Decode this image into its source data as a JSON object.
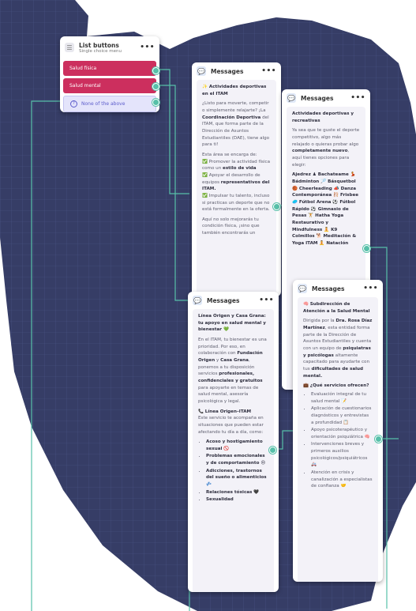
{
  "list_node": {
    "title": "List buttons",
    "subtitle": "Single choice menu",
    "options": [
      "Salud física",
      "Salud mental"
    ],
    "none_label": "None of the above"
  },
  "messages_header": "Messages",
  "msg1": {
    "heading": "✨ Actividades deportivas en el ITAM",
    "intro_a": "¿Listo para moverte, competir o simplemente relajarte? ¡La ",
    "intro_bold": "Coordinación Deportiva",
    "intro_b": " del ITAM, que forma parte de la Dirección de Asuntos Estudiantiles (DAE), tiene algo para ti!",
    "area_intro": "Esta área se encarga de:",
    "item1_a": "Promover la actividad física como un ",
    "item1_bold": "estilo de vida",
    "item2_a": "Apoyar el desarrollo de equipos ",
    "item2_bold": "representativos del ITAM.",
    "item3": "Impulsar tu talento, incluso si practicas un deporte que no está formalmente en la oferta.",
    "outro": "Aquí no solo mejorarás tu condición física, ¡sino que también encontrarás un"
  },
  "msg2": {
    "heading": "Actividades deportivas y recreativas",
    "intro_a": "Ya sea que te guste el deporte competitivo, algo más relajado o quieras probar algo ",
    "intro_bold": "completamente nuevo",
    "intro_b": ", aquí tienes opciones para elegir:",
    "activities": "Ajedrez ♟ Bachateame 💃 Bádminton 🏸 Básquetbol 🏀 Cheerleading 📣 Danza Contemporánea 🩰 Frisbee 🥏 Fútbol Arena ⚽ Fútbol Rápido ⚽ Gimnasio de Pesas 🏋 Hatha Yoga Restaurativo y Mindfulness 🧘 K9 Colmillos 🐕 Meditación & Yoga ITAM 🧘 Natación"
  },
  "msg3": {
    "heading": "Línea Origen y Casa Grana: tu apoyo en salud mental y bienestar 💚",
    "p1_a": "En el ITAM, tu bienestar es una prioridad. Por eso, en colaboración con ",
    "p1_bold1": "Fundación Origen",
    "p1_b": " y ",
    "p1_bold2": "Casa Grana",
    "p1_c": ", ponemos a tu disposición servicios ",
    "p1_bold3": "profesionales, confidenciales y gratuitos",
    "p1_d": " para apoyarte en temas de salud mental, asesoría psicológica y legal.",
    "sub_heading": "Línea Origen–ITAM",
    "sub_text": "Este servicio te acompaña en situaciones que pueden estar afectando tu día a día, como:",
    "list": [
      "Acoso y hostigamiento sexual 🚫",
      "Problemas emocionales y de comportamiento 😔",
      "Adicciones, trastornos del sueño o alimenticios 💤",
      "Relaciones tóxicas 🖤",
      "Sexualidad"
    ]
  },
  "msg4": {
    "heading": "Subdirección de Atención a la Salud Mental",
    "p1_a": "Dirigida por la ",
    "p1_bold1": "Dra. Rosa Díaz Martínez",
    "p1_b": ", esta entidad forma parte de la Dirección de Asuntos Estudiantiles y cuenta con un equipo de ",
    "p1_bold2": "psiquiatras y psicólogas",
    "p1_c": " altamente capacitado para ayudarte con tus ",
    "p1_bold3": "dificultades de salud mental.",
    "q": "¿Qué servicios ofrecen?",
    "services": [
      "Evaluación integral de tu salud mental 📝",
      "Aplicación de cuestionarios diagnósticos y entrevistas a profundidad 📋",
      "Apoyo psicoterapéutico y orientación psiquiátrica 🧠",
      "Intervenciones breves y primeros auxilios psicológicos/psiquiátricos 🚑",
      "Atención en crisis y canalización a especialistas de confianza 🤝"
    ]
  }
}
